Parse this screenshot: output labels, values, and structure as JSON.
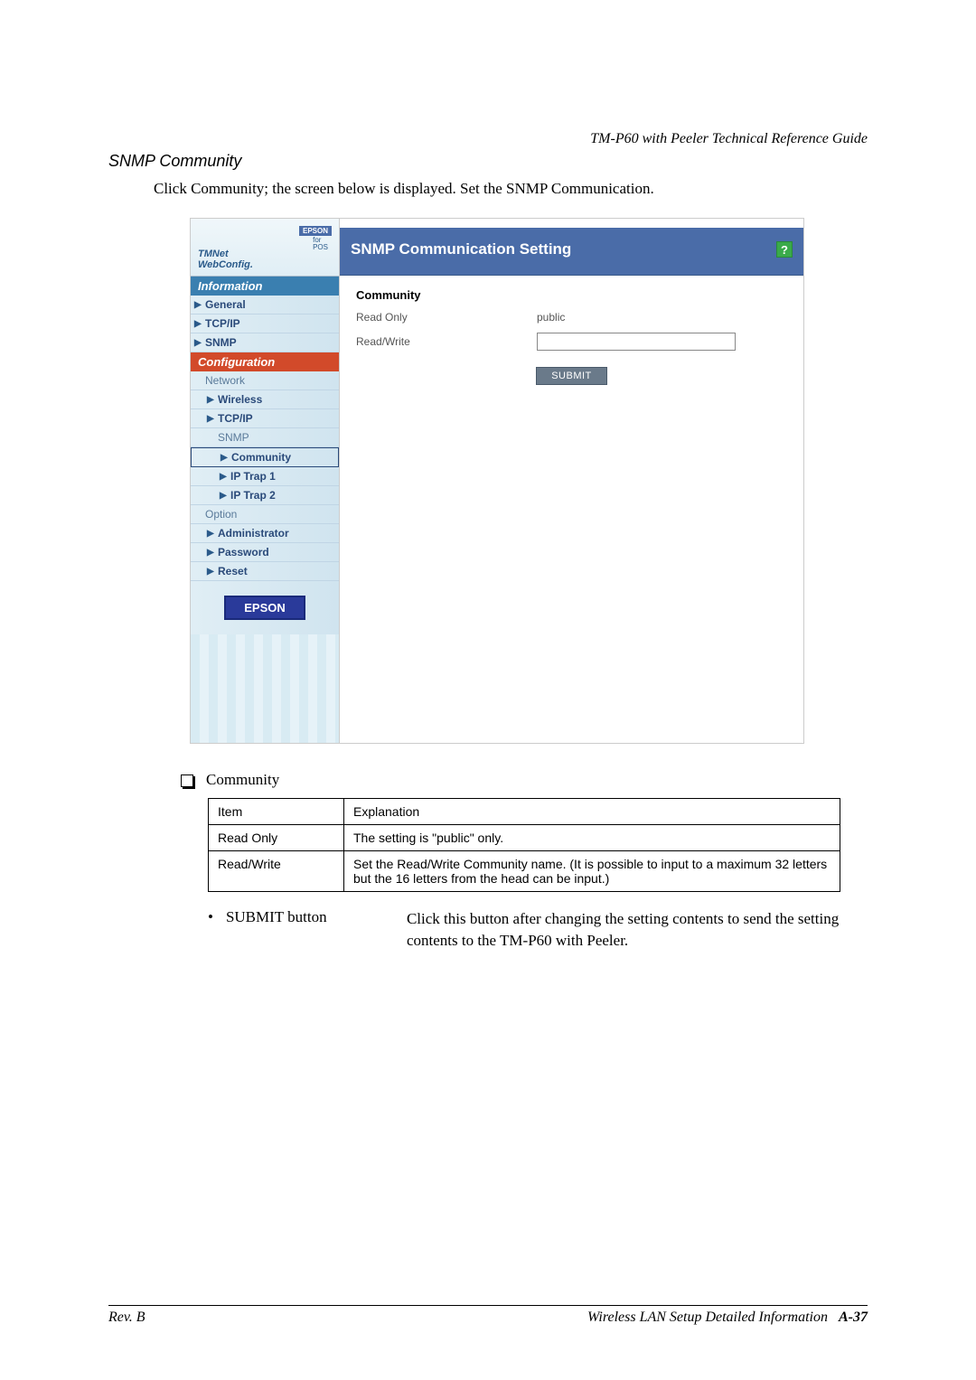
{
  "doc_header": "TM-P60 with Peeler Technical Reference Guide",
  "section_title": "SNMP Community",
  "intro": "Click Community; the screen below is displayed. Set the SNMP Communication.",
  "screenshot": {
    "logo": {
      "brand": "EPSON",
      "for": "for",
      "pos": "POS",
      "tmnet_line1": "TMNet",
      "tmnet_line2": "WebConfig."
    },
    "nav": {
      "info_header": "Information",
      "info_items": [
        "General",
        "TCP/IP",
        "SNMP"
      ],
      "config_header": "Configuration",
      "network_label": "Network",
      "network_items": [
        "Wireless",
        "TCP/IP"
      ],
      "snmp_label": "SNMP",
      "snmp_items": [
        "Community",
        "IP Trap 1",
        "IP Trap 2"
      ],
      "option_label": "Option",
      "option_items": [
        "Administrator",
        "Password",
        "Reset"
      ],
      "epson_badge": "EPSON"
    },
    "content": {
      "title": "SNMP Communication Setting",
      "help": "?",
      "group_title": "Community",
      "readonly_label": "Read Only",
      "readonly_value": "public",
      "readwrite_label": "Read/Write",
      "readwrite_value": "",
      "submit": "SUBMIT"
    }
  },
  "community_bullet": "Community",
  "table": {
    "h1": "Item",
    "h2": "Explanation",
    "r1c1": "Read Only",
    "r1c2": "The setting is \"public\" only.",
    "r2c1": "Read/Write",
    "r2c2": "Set the Read/Write Community name. (It is possible to input to a maximum 32 letters but the 16 letters from the head can be input.)"
  },
  "submit_item": {
    "label": "SUBMIT button",
    "desc": "Click this button after changing the setting contents to send the setting contents to the TM-P60 with Peeler."
  },
  "footer": {
    "rev": "Rev. B",
    "right_text": "Wireless LAN Setup Detailed Information",
    "page": "A-37"
  }
}
